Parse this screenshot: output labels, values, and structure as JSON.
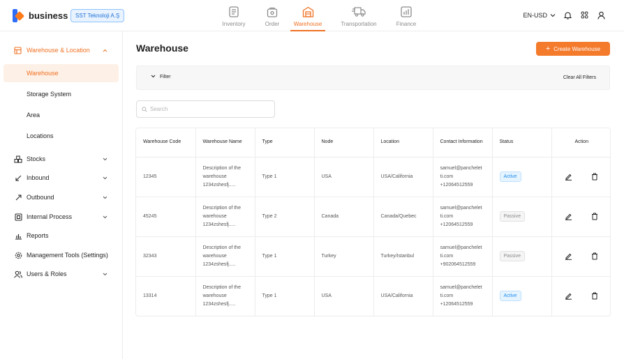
{
  "brand": {
    "name": "business",
    "company": "SST Teknoloji A.Ş"
  },
  "topnav": [
    {
      "label": "Inventory",
      "icon": "inventory-icon"
    },
    {
      "label": "Order",
      "icon": "order-icon"
    },
    {
      "label": "Warehouse",
      "icon": "warehouse-icon"
    },
    {
      "label": "Transportation",
      "icon": "truck-icon"
    },
    {
      "label": "Finance",
      "icon": "finance-icon"
    }
  ],
  "topright": {
    "currency": "EN-USD"
  },
  "sidebar": {
    "group": {
      "label": "Warehouse & Location",
      "items": [
        "Warehouse",
        "Storage System",
        "Area",
        "Locations"
      ]
    },
    "items": [
      {
        "label": "Stocks",
        "icon": "stocks-icon"
      },
      {
        "label": "Inbound",
        "icon": "inbound-icon"
      },
      {
        "label": "Outbound",
        "icon": "outbound-icon"
      },
      {
        "label": "Internal Process",
        "icon": "internal-process-icon"
      },
      {
        "label": "Reports",
        "icon": "reports-icon"
      },
      {
        "label": "Management Tools (Settings)",
        "icon": "settings-icon"
      },
      {
        "label": "Users & Roles",
        "icon": "users-icon"
      }
    ]
  },
  "page": {
    "title": "Warehouse",
    "create_button": "Create Warehouse",
    "filter_label": "Filter",
    "clear_filters": "Clear All Filters",
    "search_placeholder": "Search"
  },
  "table": {
    "headers": [
      "Warehouse Code",
      "Warehouse Name",
      "Type",
      "Node",
      "Location",
      "Contact Information",
      "Status",
      "Action"
    ],
    "rows": [
      {
        "code": "12345",
        "name": "Description of the warehouse 1234zshesfj.....",
        "type": "Type 1",
        "node": "USA",
        "location": "USA/California",
        "email": "samuel@panchelet ti.com",
        "phone": "+12064512559",
        "status": "Active"
      },
      {
        "code": "45245",
        "name": "Description of the warehouse 1234zshesfj.....",
        "type": "Type 2",
        "node": "Canada",
        "location": "Canada/Quebec",
        "email": "samuel@panchelet ti.com",
        "phone": "+12064512559",
        "status": "Passive"
      },
      {
        "code": "32343",
        "name": "Description of the warehouse 1234zshesfj.....",
        "type": "Type 1",
        "node": "Turkey",
        "location": "Turkey/Istanbul",
        "email": "samuel@panchelet ti.com",
        "phone": "+902064512559",
        "status": "Passive"
      },
      {
        "code": "13314",
        "name": "Description of the warehouse 1234zshesfj.....",
        "type": "Type 1",
        "node": "USA",
        "location": "USA/California",
        "email": "samuel@panchelet ti.com",
        "phone": "+12064512559",
        "status": "Active"
      }
    ]
  },
  "colors": {
    "accent": "#f07022",
    "button": "#f47a2c",
    "active_badge": "#1f8ef1",
    "passive_badge": "#8a8a8a"
  }
}
